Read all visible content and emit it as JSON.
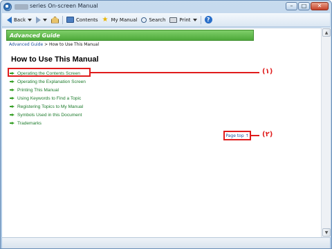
{
  "window": {
    "title": "series On-screen Manual"
  },
  "toolbar": {
    "back_label": "Back",
    "contents_label": "Contents",
    "my_manual_label": "My Manual",
    "search_label": "Search",
    "print_label": "Print"
  },
  "page": {
    "header": "Advanced Guide",
    "breadcrumb_link": "Advanced Guide",
    "breadcrumb_sep": " > ",
    "breadcrumb_current": "How to Use This Manual",
    "title": "How to Use This Manual",
    "links": [
      "Operating the Contents Screen",
      "Operating the Explanation Screen",
      "Printing This Manual",
      "Using Keywords to Find a Topic",
      "Registering Topics to My Manual",
      "Symbols Used in this Document",
      "Trademarks"
    ],
    "page_top": "Page top ↑"
  },
  "callouts": {
    "label1": "(١)",
    "label2": "(٢)"
  },
  "colors": {
    "header_green": "#4ea93a",
    "link_green": "#1b7a2a",
    "callout_red": "#e01b1b",
    "link_blue": "#1a4f9c"
  }
}
